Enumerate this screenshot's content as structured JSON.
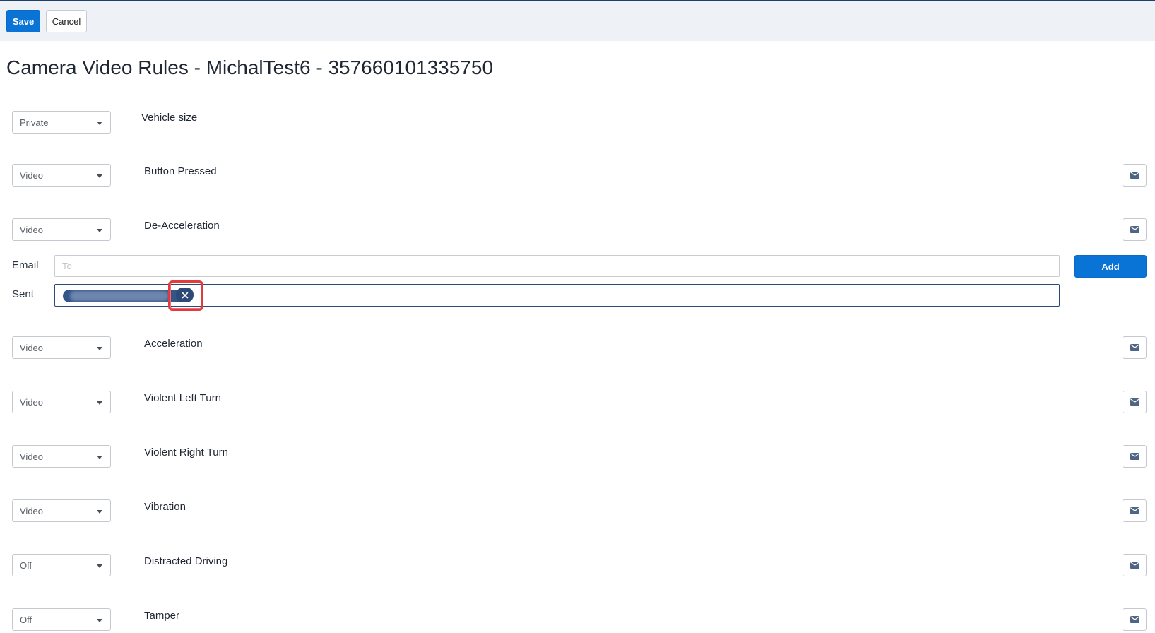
{
  "toolbar": {
    "save_label": "Save",
    "cancel_label": "Cancel"
  },
  "page": {
    "title": "Camera Video Rules - MichalTest6 - 357660101335750"
  },
  "rules": [
    {
      "value": "Private",
      "label": "Vehicle size",
      "has_email": false
    },
    {
      "value": "Video",
      "label": "Button Pressed",
      "has_email": true
    },
    {
      "value": "Video",
      "label": "De-Acceleration",
      "has_email": true
    },
    {
      "value": "Video",
      "label": "Acceleration",
      "has_email": true
    },
    {
      "value": "Video",
      "label": "Violent Left Turn",
      "has_email": true
    },
    {
      "value": "Video",
      "label": "Violent Right Turn",
      "has_email": true
    },
    {
      "value": "Video",
      "label": "Vibration",
      "has_email": true
    },
    {
      "value": "Off",
      "label": "Distracted Driving",
      "has_email": true
    },
    {
      "value": "Off",
      "label": "Tamper",
      "has_email": true
    }
  ],
  "email_panel": {
    "email_label": "Email",
    "to_placeholder": "To",
    "add_label": "Add",
    "sent_label": "Sent"
  },
  "colors": {
    "primary": "#0a74d6",
    "chip": "#355587",
    "highlight": "#e23a3f"
  },
  "icons": {
    "mail": "envelope-icon",
    "close": "close-icon",
    "caret": "chevron-down-icon"
  }
}
